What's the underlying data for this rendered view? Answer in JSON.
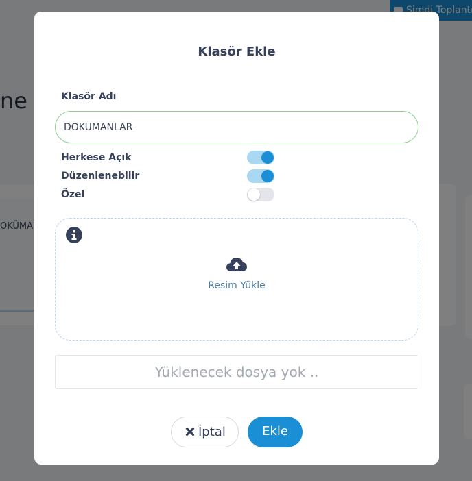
{
  "background": {
    "top_button_label": "Şimdi Toplantı",
    "heading_fragment": "ne",
    "card_label_fragment": "OKÜMAN"
  },
  "modal": {
    "title": "Klasör Ekle",
    "folder_name_label": "Klasör Adı",
    "folder_name_value": "DOKUMANLAR",
    "toggles": [
      {
        "label": "Herkese Açık",
        "on": true
      },
      {
        "label": "Düzenlenebilir",
        "on": true
      },
      {
        "label": "Özel",
        "on": false
      }
    ],
    "upload": {
      "label": "Resim Yükle",
      "info_icon": "info-circle-icon",
      "upload_icon": "cloud-upload-icon"
    },
    "file_status": "Yüklenecek dosya yok ..",
    "buttons": {
      "cancel_label": "İptal",
      "add_label": "Ekle"
    }
  },
  "colors": {
    "accent": "#1a8fd6",
    "title_text": "#36405a",
    "input_border": "#8fcf8f",
    "switch_track_on": "#a9d8f2",
    "overlay": "rgba(0,0,0,0.5)"
  }
}
